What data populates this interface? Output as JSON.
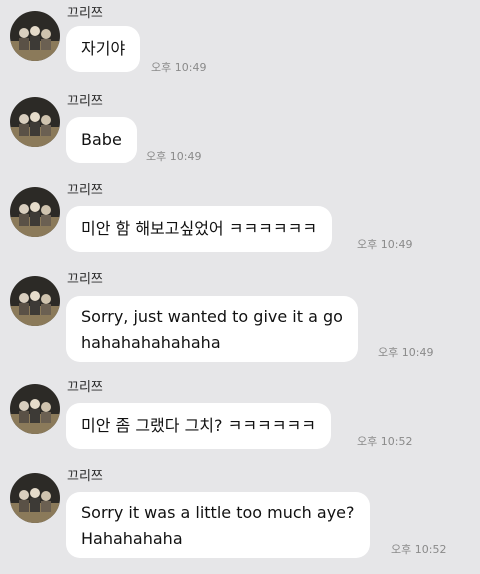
{
  "messages": [
    {
      "sender": "끄리쯔",
      "lines": [
        "자기야"
      ],
      "time": "오후 10:49"
    },
    {
      "sender": "끄리쯔",
      "lines": [
        "Babe"
      ],
      "time": "오후 10:49"
    },
    {
      "sender": "끄리쯔",
      "lines": [
        "미안 함 해보고싶었어 ㅋㅋㅋㅋㅋㅋ"
      ],
      "time": "오후 10:49"
    },
    {
      "sender": "끄리쯔",
      "lines": [
        "Sorry, just wanted to give it a go",
        "hahahahahahaha"
      ],
      "time": "오후 10:49"
    },
    {
      "sender": "끄리쯔",
      "lines": [
        "미안 좀 그랬다 그치? ㅋㅋㅋㅋㅋㅋ"
      ],
      "time": "오후 10:52"
    },
    {
      "sender": "끄리쯔",
      "lines": [
        "Sorry it was a little too much aye?",
        "Hahahahaha"
      ],
      "time": "오후 10:52"
    }
  ],
  "colors": {
    "background": "#e6e6e8",
    "bubble": "#ffffff",
    "timestamp": "#8a8a8a"
  },
  "icons": {
    "avatar": "profile-photo-avatar-icon"
  }
}
